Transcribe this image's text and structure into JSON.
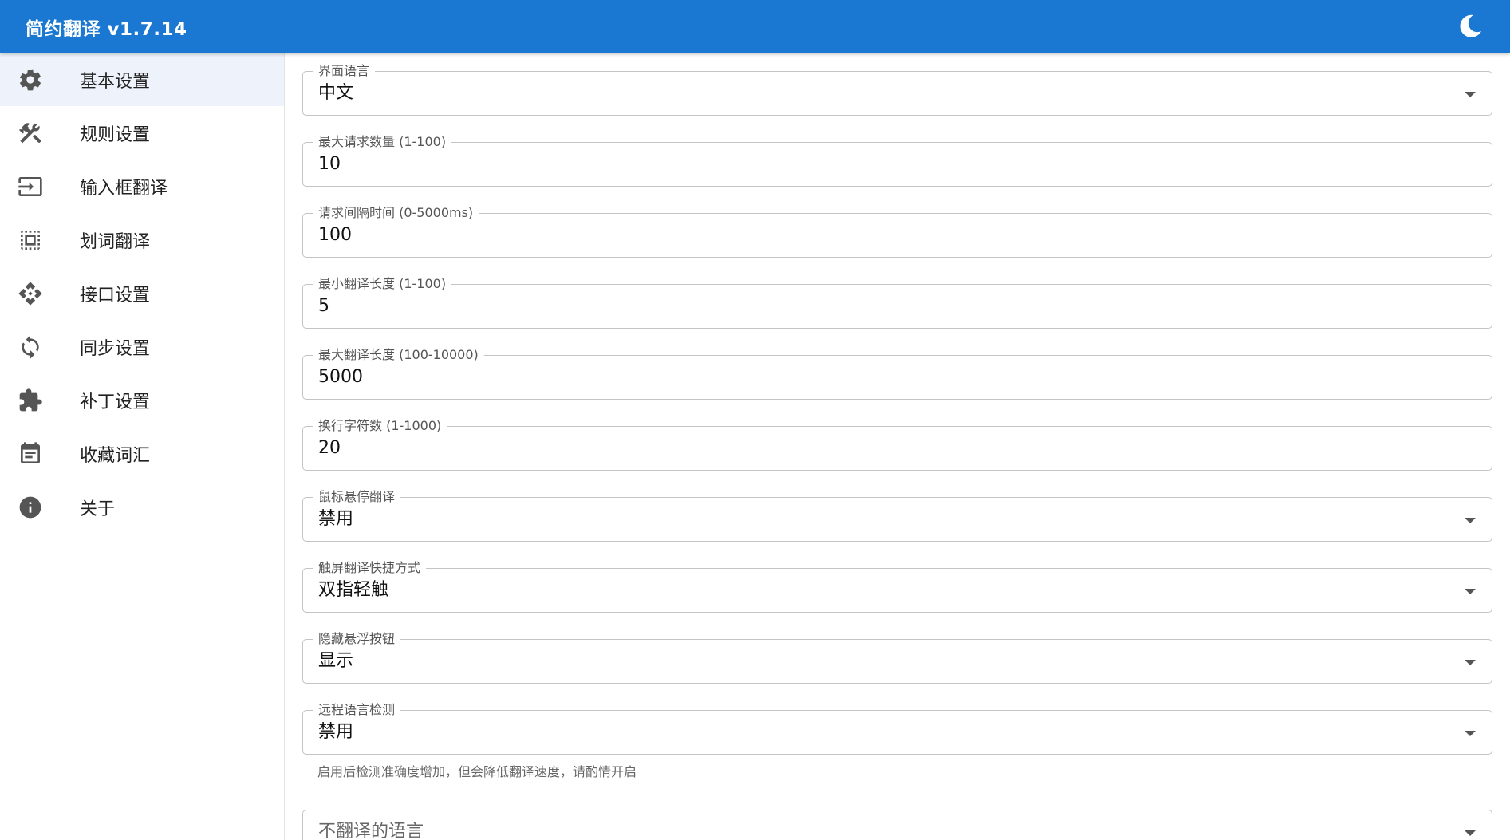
{
  "app": {
    "title": "简约翻译 v1.7.14",
    "theme_icon": "moon-icon",
    "colors": {
      "primary": "#1a77d2",
      "active_bg": "#eef3fb"
    }
  },
  "sidebar": {
    "items": [
      {
        "label": "基本设置",
        "icon": "gear-icon",
        "active": true
      },
      {
        "label": "规则设置",
        "icon": "tools-icon"
      },
      {
        "label": "输入框翻译",
        "icon": "input-icon"
      },
      {
        "label": "划词翻译",
        "icon": "select-icon"
      },
      {
        "label": "接口设置",
        "icon": "api-icon"
      },
      {
        "label": "同步设置",
        "icon": "sync-icon"
      },
      {
        "label": "补丁设置",
        "icon": "patch-icon"
      },
      {
        "label": "收藏词汇",
        "icon": "calendar-icon"
      },
      {
        "label": "关于",
        "icon": "info-icon"
      }
    ]
  },
  "settings": {
    "ui_language": {
      "label": "界面语言",
      "value": "中文"
    },
    "max_requests": {
      "label": "最大请求数量 (1-100)",
      "value": "10"
    },
    "request_interval": {
      "label": "请求间隔时间 (0-5000ms)",
      "value": "100"
    },
    "min_length": {
      "label": "最小翻译长度 (1-100)",
      "value": "5"
    },
    "max_length": {
      "label": "最大翻译长度 (100-10000)",
      "value": "5000"
    },
    "newline_chars": {
      "label": "换行字符数 (1-1000)",
      "value": "20"
    },
    "hover_translate": {
      "label": "鼠标悬停翻译",
      "value": "禁用"
    },
    "touch_shortcut": {
      "label": "触屏翻译快捷方式",
      "value": "双指轻触"
    },
    "hide_fab": {
      "label": "隐藏悬浮按钮",
      "value": "显示"
    },
    "remote_detect": {
      "label": "远程语言检测",
      "value": "禁用",
      "helper": "启用后检测准确度增加，但会降低翻译速度，请酌情开启"
    },
    "skip_langs": {
      "label": "",
      "placeholder": "不翻译的语言"
    }
  }
}
